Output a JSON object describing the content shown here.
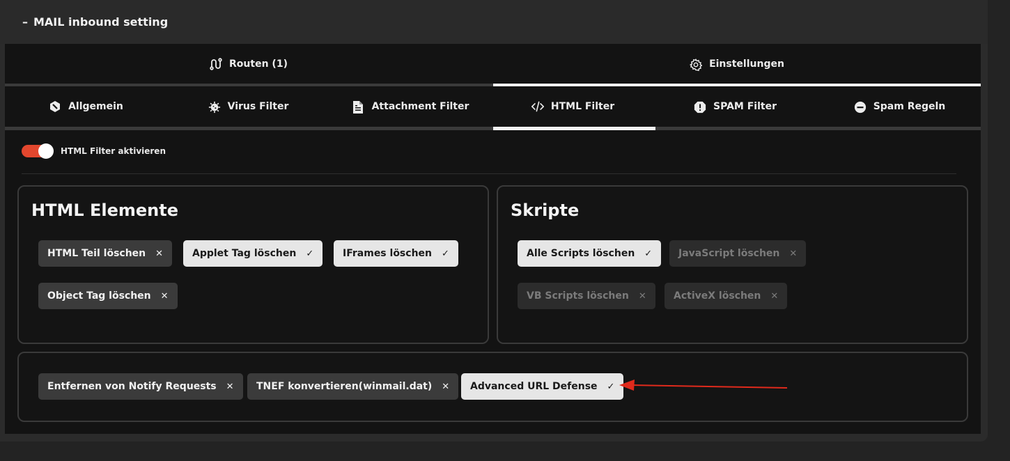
{
  "header": {
    "dash": "–",
    "title": "MAIL inbound setting"
  },
  "tabs_main": [
    {
      "label": "Routen (1)",
      "icon": "route-icon",
      "active": false
    },
    {
      "label": "Einstellungen",
      "icon": "gear-icon",
      "active": true
    }
  ],
  "tabs_sub": [
    {
      "label": "Allgemein",
      "icon": "hexagon-icon",
      "active": false
    },
    {
      "label": "Virus Filter",
      "icon": "virus-icon",
      "active": false
    },
    {
      "label": "Attachment Filter",
      "icon": "file-icon",
      "active": false
    },
    {
      "label": "HTML Filter",
      "icon": "code-icon",
      "active": true
    },
    {
      "label": "SPAM Filter",
      "icon": "exclamation-octagon-icon",
      "active": false
    },
    {
      "label": "Spam Regeln",
      "icon": "minus-circle-icon",
      "active": false
    }
  ],
  "toggle": {
    "label": "HTML Filter aktivieren",
    "enabled": true
  },
  "html_elements": {
    "title": "HTML Elemente",
    "chips": [
      {
        "label": "HTML Teil löschen",
        "state": "off",
        "mark": "✕"
      },
      {
        "label": "Applet Tag löschen",
        "state": "on",
        "mark": "✓"
      },
      {
        "label": "IFrames löschen",
        "state": "on",
        "mark": "✓"
      },
      {
        "label": "Object Tag löschen",
        "state": "off",
        "mark": "✕"
      }
    ]
  },
  "scripts": {
    "title": "Skripte",
    "chips": [
      {
        "label": "Alle Scripts löschen",
        "state": "on",
        "mark": "✓"
      },
      {
        "label": "JavaScript löschen",
        "state": "disabled",
        "mark": "✕"
      },
      {
        "label": "VB Scripts löschen",
        "state": "disabled",
        "mark": "✕"
      },
      {
        "label": "ActiveX löschen",
        "state": "disabled",
        "mark": "✕"
      }
    ]
  },
  "misc": {
    "chips": [
      {
        "label": "Entfernen von Notify Requests",
        "state": "off",
        "mark": "✕"
      },
      {
        "label": "TNEF konvertieren(winmail.dat)",
        "state": "off",
        "mark": "✕"
      },
      {
        "label": "Advanced URL Defense",
        "state": "on",
        "mark": "✓"
      }
    ]
  },
  "colors": {
    "accent_toggle": "#e3472e",
    "annotation_arrow": "#e02a1c"
  }
}
